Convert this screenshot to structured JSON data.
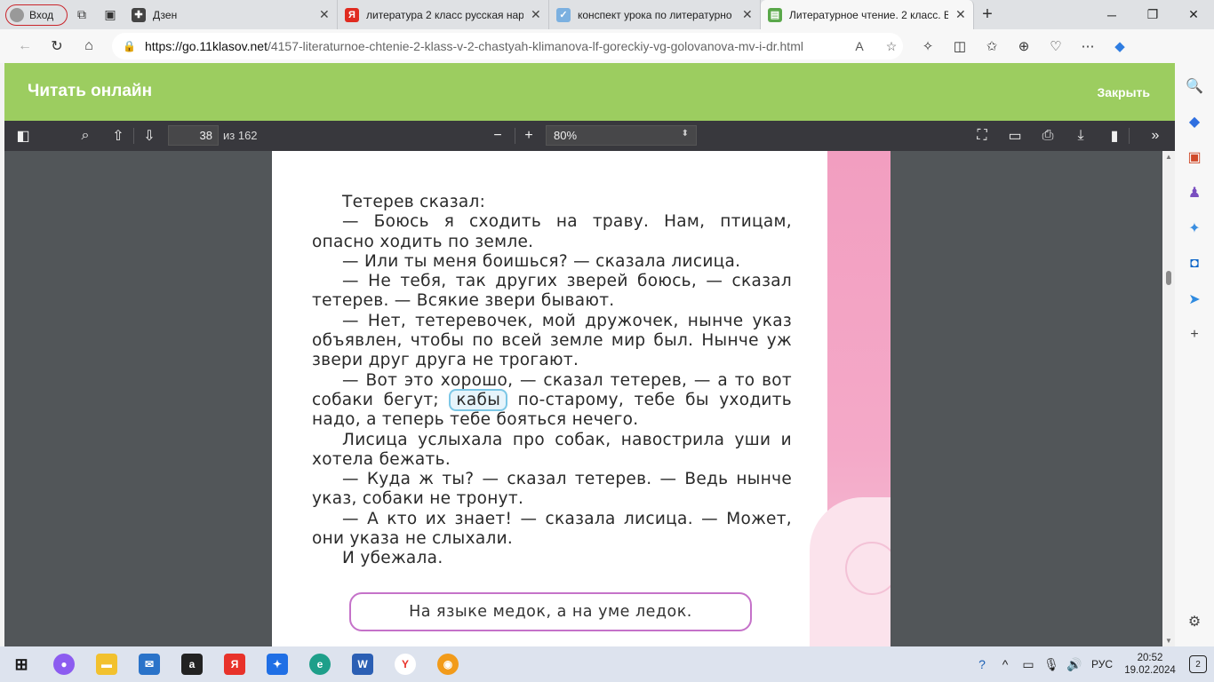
{
  "browser": {
    "profile_label": "Вход",
    "tabs": [
      {
        "title": "Дзен",
        "favicon_color": "#444444",
        "favicon_glyph": "✚"
      },
      {
        "title": "литература 2 класс русская нар",
        "favicon_color": "#e02b20",
        "favicon_glyph": "Я"
      },
      {
        "title": "конспект урока по литературно",
        "favicon_color": "#7bb0e0",
        "favicon_glyph": "✓"
      },
      {
        "title": "Литературное чтение. 2 класс. В",
        "favicon_color": "#5aa84a",
        "favicon_glyph": "▤",
        "active": true
      }
    ],
    "url_host": "https://go.11klasov.net",
    "url_path": "/4157-literaturnoe-chtenie-2-klass-v-2-chastyah-klimanova-lf-goreckiy-vg-golovanova-mv-i-dr.html"
  },
  "site": {
    "title": "Читать онлайн",
    "close_label": "Закрыть"
  },
  "pdf_toolbar": {
    "page_number": "38",
    "page_count": "из 162",
    "zoom": "80%"
  },
  "pdf_page": {
    "paragraphs": [
      "Тетерев сказал:",
      "— Боюсь я сходить на траву. Нам, птицам, опасно ходить по земле.",
      "— Или ты меня боишься? — сказала лисица.",
      "— Не тебя, так других зверей боюсь, — сказал тетерев. — Всякие звери бывают.",
      "— Нет, тетеревочек, мой дружочек, нынче указ объявлен, чтобы по всей земле мир был. Нынче уж звери друг друга не трогают."
    ],
    "p6_before": "— Вот это хорошо, — сказал тетерев, — а то вот собаки бегут;",
    "p6_highlight": "кабы",
    "p6_after": "по-старому, тебе бы уходить надо, а теперь тебе бояться нечего.",
    "paragraphs_after": [
      "Лисица услыхала про собак, навострила уши и хотела бежать.",
      "— Куда ж ты? — сказал тетерев. — Ведь нынче указ, собаки не тронут.",
      "— А кто их знает! — сказала лисица. — Может, они указа не слыхали.",
      "И убежала."
    ],
    "proverb": "На языке медок, а на уме ледок."
  },
  "taskbar": {
    "lang": "РУС",
    "time": "20:52",
    "date": "19.02.2024",
    "notifications": "2"
  }
}
